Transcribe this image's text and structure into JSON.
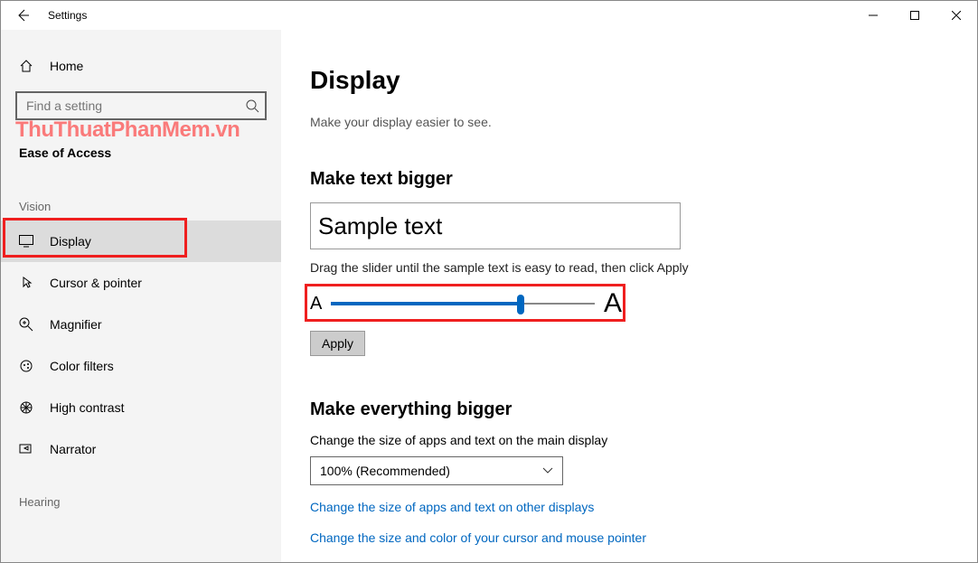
{
  "titlebar": {
    "title": "Settings"
  },
  "sidebar": {
    "home": "Home",
    "search_placeholder": "Find a setting",
    "watermark": "ThuThuatPhanMem.vn",
    "category": "Ease of Access",
    "groups": {
      "vision": "Vision",
      "hearing": "Hearing"
    },
    "items": [
      {
        "label": "Display",
        "icon": "display-icon"
      },
      {
        "label": "Cursor & pointer",
        "icon": "cursor-icon"
      },
      {
        "label": "Magnifier",
        "icon": "magnifier-icon"
      },
      {
        "label": "Color filters",
        "icon": "color-filters-icon"
      },
      {
        "label": "High contrast",
        "icon": "high-contrast-icon"
      },
      {
        "label": "Narrator",
        "icon": "narrator-icon"
      }
    ]
  },
  "content": {
    "page_title": "Display",
    "page_sub": "Make your display easier to see.",
    "section1": {
      "heading": "Make text bigger",
      "sample_text": "Sample text",
      "slider_help": "Drag the slider until the sample text is easy to read, then click Apply",
      "slider_a_small": "A",
      "slider_a_big": "A",
      "apply": "Apply"
    },
    "section2": {
      "heading": "Make everything bigger",
      "sub": "Change the size of apps and text on the main display",
      "dropdown_value": "100% (Recommended)",
      "link1": "Change the size of apps and text on other displays",
      "link2": "Change the size and color of your cursor and mouse pointer"
    }
  }
}
